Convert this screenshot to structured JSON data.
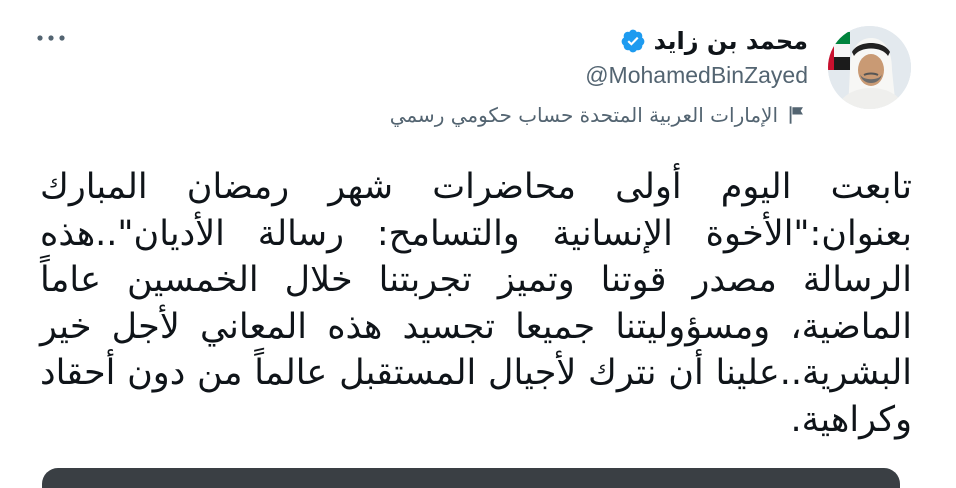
{
  "tweet": {
    "author": {
      "display_name": "محمد بن زايد",
      "handle": "@MohamedBinZayed",
      "verified": true,
      "avatar_icon": "profile-photo-avatar"
    },
    "government_label": "الإمارات العربية المتحدة حساب حكومي رسمي",
    "text": "تابعت اليوم أولى محاضرات شهر رمضان المبارك بعنوان:\"الأخوة الإنسانية والتسامح: رسالة الأديان\"..هذه الرسالة مصدر قوتنا وتميز تجربتنا خلال الخمسين عاماً الماضية، ومسؤوليتنا جميعا تجسيد هذه المعاني لأجل خير البشرية..علينا أن نترك لأجيال المستقبل عالماً من دون أحقاد وكراهية.",
    "more_icon": "more-options-icon"
  },
  "colors": {
    "primary_text": "#0f1419",
    "secondary_text": "#536471",
    "verified_blue": "#1d9bf0",
    "background": "#ffffff"
  }
}
